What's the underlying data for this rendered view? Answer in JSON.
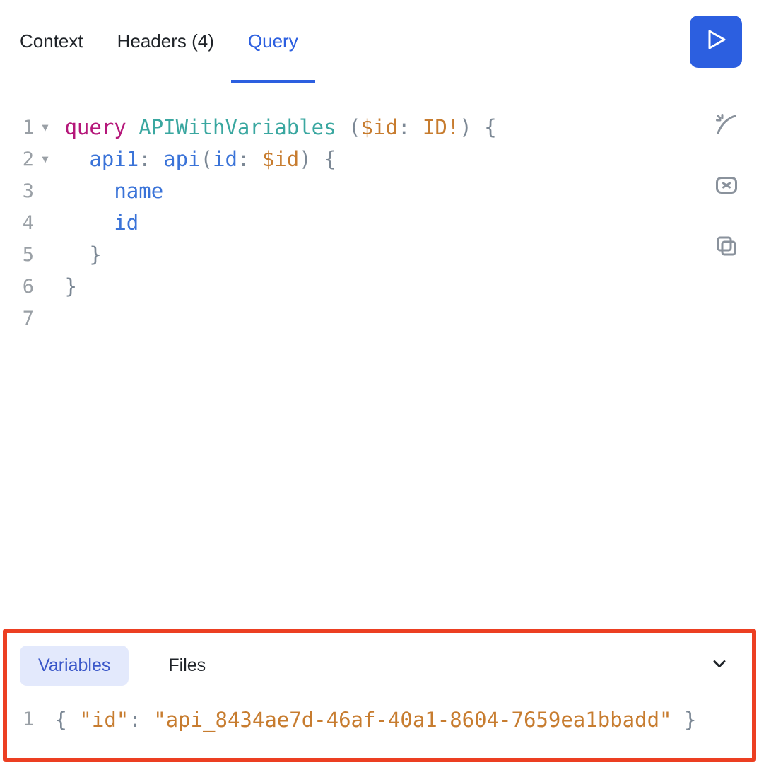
{
  "topTabs": {
    "context": "Context",
    "headers": "Headers (4)",
    "query": "Query",
    "activeIndex": 2
  },
  "runButton": {
    "name": "run-button"
  },
  "sideIcons": {
    "prettify": "prettify-icon",
    "clear": "clear-icon",
    "copy": "copy-icon"
  },
  "queryEditor": {
    "lines": [
      {
        "n": "1",
        "foldable": true
      },
      {
        "n": "2",
        "foldable": true
      },
      {
        "n": "3",
        "foldable": false
      },
      {
        "n": "4",
        "foldable": false
      },
      {
        "n": "5",
        "foldable": false
      },
      {
        "n": "6",
        "foldable": false
      },
      {
        "n": "7",
        "foldable": false
      }
    ],
    "tokens": {
      "l1_query": "query",
      "l1_name": "APIWithVariables",
      "l1_lparen": "(",
      "l1_var": "$id",
      "l1_colon": ":",
      "l1_type": "ID",
      "l1_bang": "!",
      "l1_rparen": ")",
      "l1_lbrace": "{",
      "l2_alias": "api1",
      "l2_aliasColon": ":",
      "l2_field": "api",
      "l2_lparen": "(",
      "l2_arg": "id",
      "l2_argColon": ":",
      "l2_argVar": "$id",
      "l2_rparen": ")",
      "l2_lbrace": "{",
      "l3_field": "name",
      "l4_field": "id",
      "l5_rbrace": "}",
      "l6_rbrace": "}"
    }
  },
  "variablesPanel": {
    "tabs": {
      "variables": "Variables",
      "files": "Files",
      "activeIndex": 0
    },
    "editor": {
      "lineNumber": "1",
      "tokens": {
        "lbrace": "{",
        "key": "\"id\"",
        "colon": ":",
        "value": "\"api_8434ae7d-46af-40a1-8604-7659ea1bbadd\"",
        "rbrace": "}"
      }
    }
  }
}
